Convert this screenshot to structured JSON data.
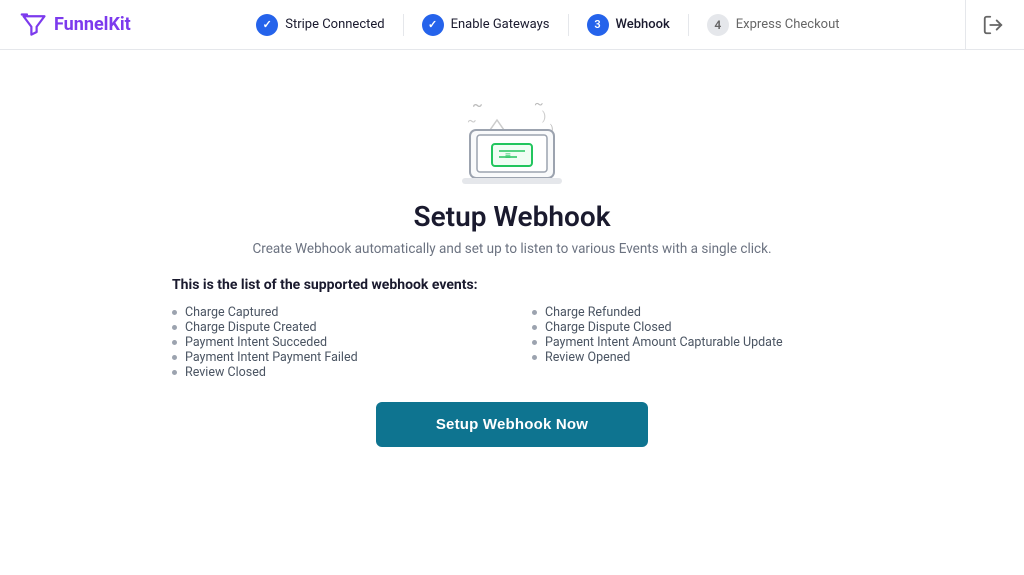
{
  "header": {
    "logo_text_bold": "Funnel",
    "logo_text_colored": "Kit"
  },
  "steps": [
    {
      "id": "stripe-connected",
      "number": "✓",
      "label": "Stripe Connected",
      "state": "completed"
    },
    {
      "id": "enable-gateways",
      "number": "✓",
      "label": "Enable Gateways",
      "state": "completed"
    },
    {
      "id": "webhook",
      "number": "3",
      "label": "Webhook",
      "state": "active"
    },
    {
      "id": "express-checkout",
      "number": "4",
      "label": "Express Checkout",
      "state": "inactive"
    }
  ],
  "main": {
    "title": "Setup Webhook",
    "subtitle": "Create Webhook automatically and set up to listen to various Events with a single click.",
    "events_title": "This is the list of the supported webhook events:",
    "events_left": [
      "Charge Captured",
      "Charge Dispute Created",
      "Payment Intent Succeded",
      "Payment Intent Payment Failed",
      "Review Closed"
    ],
    "events_right": [
      "Charge Refunded",
      "Charge Dispute Closed",
      "Payment Intent Amount Capturable Update",
      "Review Opened"
    ],
    "cta_label": "Setup Webhook Now"
  }
}
